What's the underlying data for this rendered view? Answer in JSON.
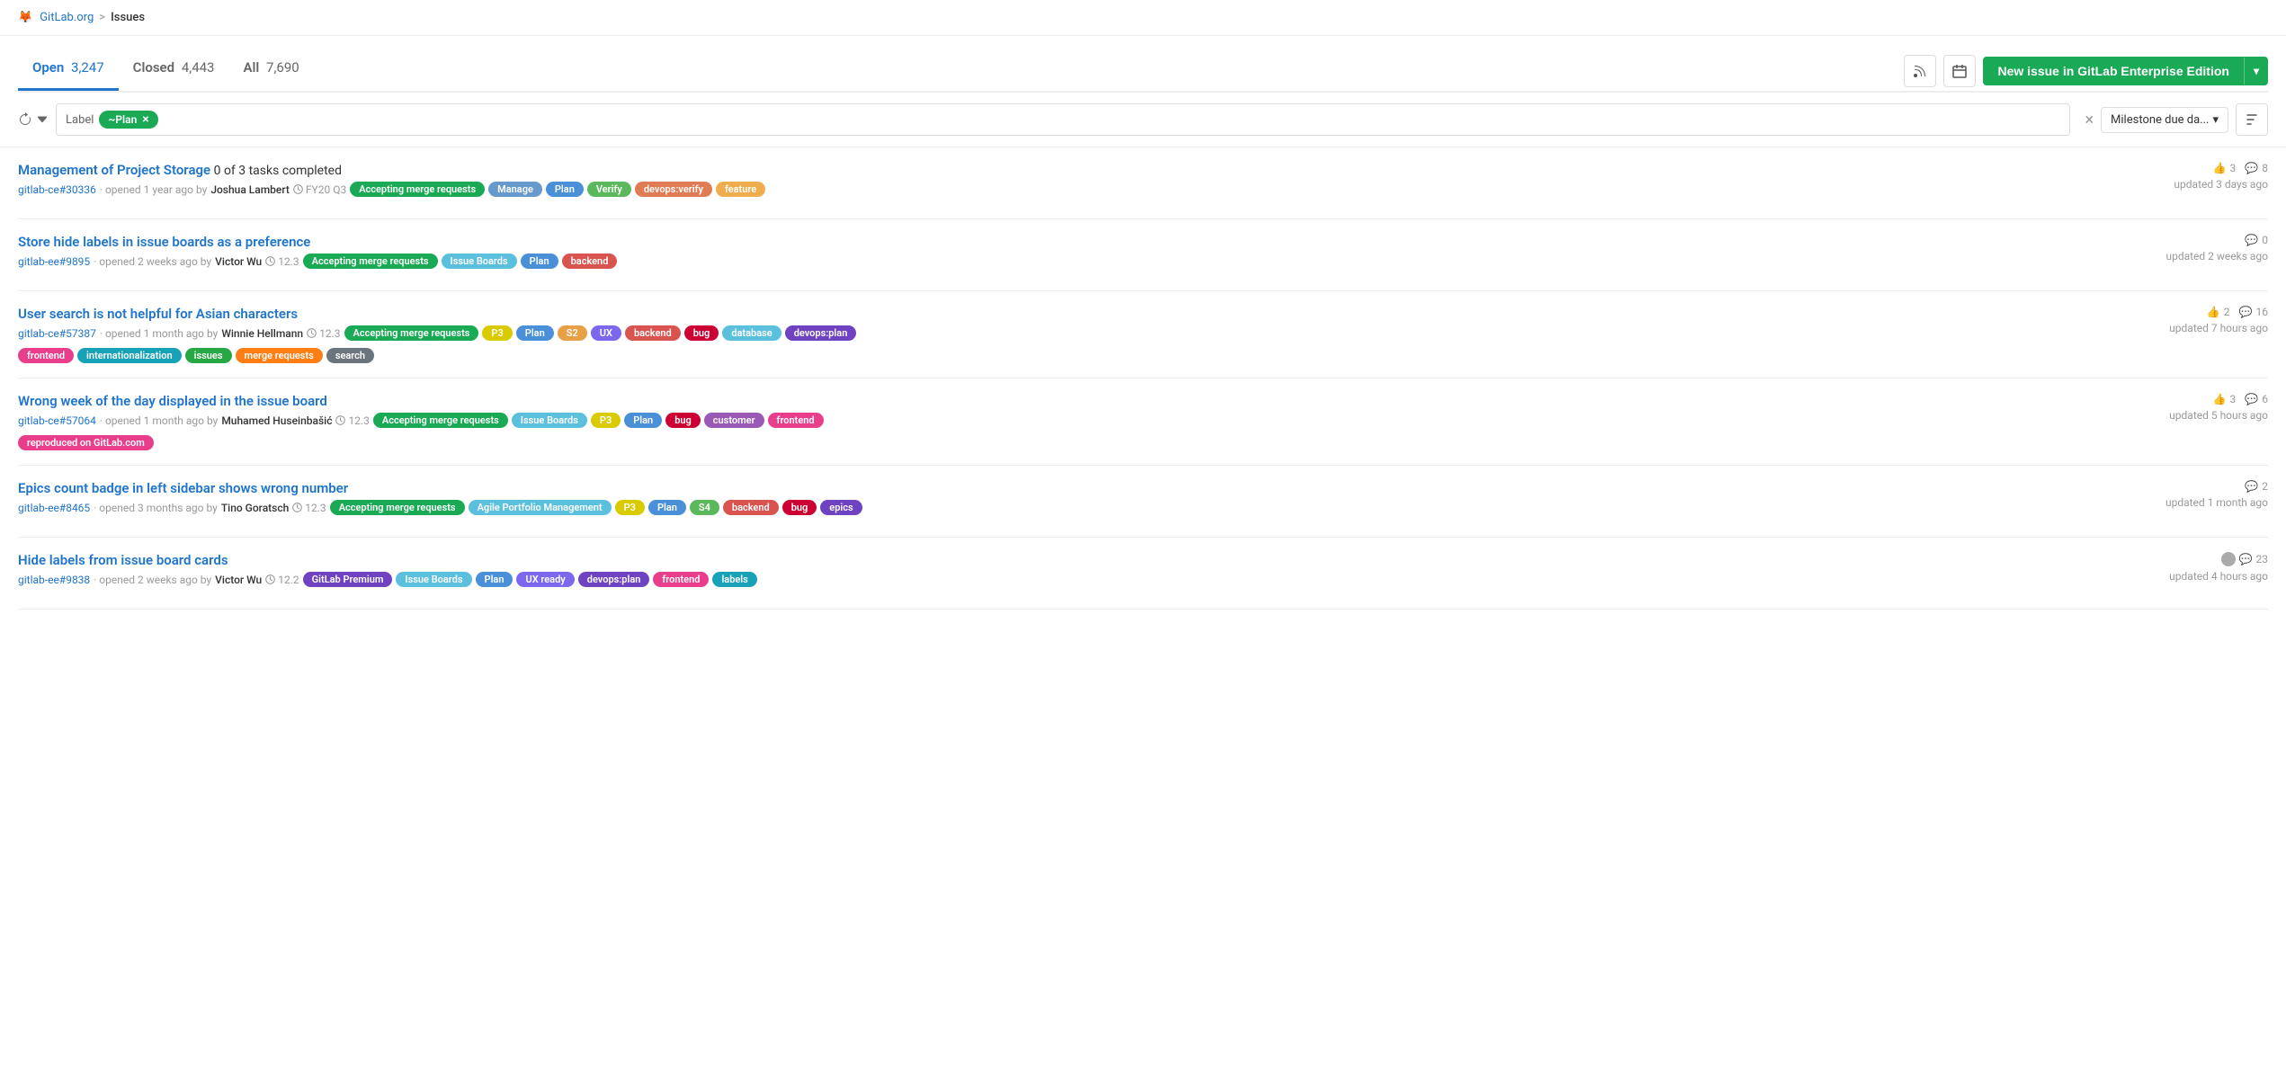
{
  "nav": {
    "logo": "🦊",
    "org": "GitLab.org",
    "separator": ">",
    "current": "Issues"
  },
  "tabs": [
    {
      "id": "open",
      "label": "Open",
      "count": "3,247",
      "active": true
    },
    {
      "id": "closed",
      "label": "Closed",
      "count": "4,443",
      "active": false
    },
    {
      "id": "all",
      "label": "All",
      "count": "7,690",
      "active": false
    }
  ],
  "header": {
    "rss_title": "RSS",
    "calendar_title": "Calendar",
    "new_issue_label": "New issue in GitLab Enterprise Edition",
    "new_issue_dropdown": "▾"
  },
  "filter": {
    "reset_title": "Reset filters",
    "label_text": "Label",
    "chip_label": "~Plan",
    "chip_close": "×",
    "clear_title": "×",
    "sort_label": "Milestone due da...",
    "sort_arrow": "▾",
    "sort_icon": "≡"
  },
  "issues": [
    {
      "title": "Management of Project Storage",
      "meta_tasks": "0 of 3 tasks completed",
      "id": "gitlab-ce#30336",
      "time": "opened 1 year ago",
      "author": "Joshua Lambert",
      "milestone": "FY20 Q3",
      "labels": [
        {
          "text": "Accepting merge requests",
          "bg": "#1aaa55"
        },
        {
          "text": "Manage",
          "bg": "#6699cc"
        },
        {
          "text": "Plan",
          "bg": "#4a90d9"
        },
        {
          "text": "Verify",
          "bg": "#5cb85c"
        },
        {
          "text": "devops:verify",
          "bg": "#e07b54"
        },
        {
          "text": "feature",
          "bg": "#f0ad4e"
        }
      ],
      "thumbs": "3",
      "comments": "8",
      "updated": "updated 3 days ago"
    },
    {
      "title": "Store hide labels in issue boards as a preference",
      "meta_tasks": "",
      "id": "gitlab-ee#9895",
      "time": "opened 2 weeks ago",
      "author": "Victor Wu",
      "milestone": "12.3",
      "labels": [
        {
          "text": "Accepting merge requests",
          "bg": "#1aaa55"
        },
        {
          "text": "Issue Boards",
          "bg": "#5bc0de"
        },
        {
          "text": "Plan",
          "bg": "#4a90d9"
        },
        {
          "text": "backend",
          "bg": "#d9534f"
        }
      ],
      "thumbs": "",
      "comments": "0",
      "updated": "updated 2 weeks ago"
    },
    {
      "title": "User search is not helpful for Asian characters",
      "meta_tasks": "",
      "id": "gitlab-ce#57387",
      "time": "opened 1 month ago",
      "author": "Winnie Hellmann",
      "milestone": "12.3",
      "labels": [
        {
          "text": "Accepting merge requests",
          "bg": "#1aaa55"
        },
        {
          "text": "P3",
          "bg": "#d9cb00"
        },
        {
          "text": "Plan",
          "bg": "#4a90d9"
        },
        {
          "text": "S2",
          "bg": "#e8a045"
        },
        {
          "text": "UX",
          "bg": "#7b68ee"
        },
        {
          "text": "backend",
          "bg": "#d9534f"
        },
        {
          "text": "bug",
          "bg": "#cc0033"
        },
        {
          "text": "database",
          "bg": "#5bc0de"
        },
        {
          "text": "devops:plan",
          "bg": "#6f42c1"
        },
        {
          "text": "frontend",
          "bg": "#e83e8c"
        },
        {
          "text": "internationalization",
          "bg": "#17a2b8"
        },
        {
          "text": "issues",
          "bg": "#28a745"
        },
        {
          "text": "merge requests",
          "bg": "#fd7e14"
        },
        {
          "text": "search",
          "bg": "#6c757d"
        }
      ],
      "thumbs": "2",
      "comments": "16",
      "updated": "updated 7 hours ago"
    },
    {
      "title": "Wrong week of the day displayed in the issue board",
      "meta_tasks": "",
      "id": "gitlab-ce#57064",
      "time": "opened 1 month ago",
      "author": "Muhamed Huseinbašić",
      "milestone": "12.3",
      "labels": [
        {
          "text": "Accepting merge requests",
          "bg": "#1aaa55"
        },
        {
          "text": "Issue Boards",
          "bg": "#5bc0de"
        },
        {
          "text": "P3",
          "bg": "#d9cb00"
        },
        {
          "text": "Plan",
          "bg": "#4a90d9"
        },
        {
          "text": "bug",
          "bg": "#cc0033"
        },
        {
          "text": "customer",
          "bg": "#9b59b6"
        },
        {
          "text": "frontend",
          "bg": "#e83e8c"
        },
        {
          "text": "reproduced on GitLab.com",
          "bg": "#e83e8c"
        }
      ],
      "thumbs": "3",
      "comments": "6",
      "updated": "updated 5 hours ago"
    },
    {
      "title": "Epics count badge in left sidebar shows wrong number",
      "meta_tasks": "",
      "id": "gitlab-ee#8465",
      "time": "opened 3 months ago",
      "author": "Tino Goratsch",
      "milestone": "12.3",
      "labels": [
        {
          "text": "Accepting merge requests",
          "bg": "#1aaa55"
        },
        {
          "text": "Agile Portfolio Management",
          "bg": "#5bc0de"
        },
        {
          "text": "P3",
          "bg": "#d9cb00"
        },
        {
          "text": "Plan",
          "bg": "#4a90d9"
        },
        {
          "text": "S4",
          "bg": "#5cb85c"
        },
        {
          "text": "backend",
          "bg": "#d9534f"
        },
        {
          "text": "bug",
          "bg": "#cc0033"
        },
        {
          "text": "epics",
          "bg": "#6f42c1"
        }
      ],
      "thumbs": "",
      "comments": "2",
      "updated": "updated 1 month ago"
    },
    {
      "title": "Hide labels from issue board cards",
      "meta_tasks": "",
      "id": "gitlab-ee#9838",
      "time": "opened 2 weeks ago",
      "author": "Victor Wu",
      "milestone": "12.2",
      "labels": [
        {
          "text": "GitLab Premium",
          "bg": "#6f42c1"
        },
        {
          "text": "Issue Boards",
          "bg": "#5bc0de"
        },
        {
          "text": "Plan",
          "bg": "#4a90d9"
        },
        {
          "text": "UX ready",
          "bg": "#7b68ee"
        },
        {
          "text": "devops:plan",
          "bg": "#6f42c1"
        },
        {
          "text": "frontend",
          "bg": "#e83e8c"
        },
        {
          "text": "labels",
          "bg": "#17a2b8"
        }
      ],
      "thumbs": "",
      "comments": "23",
      "updated": "updated 4 hours ago",
      "has_avatar": true
    }
  ]
}
